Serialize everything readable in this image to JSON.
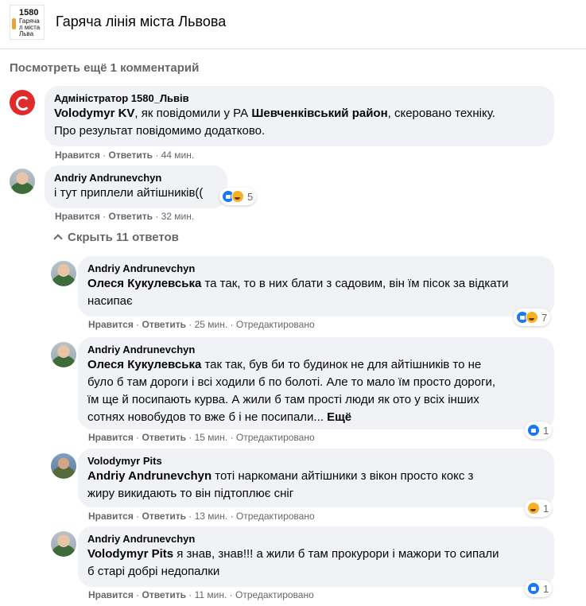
{
  "header": {
    "logo_num": "1580",
    "logo_sub": "Гаряча л міста Льва",
    "title": "Гаряча лінія міста Львова"
  },
  "see_more": "Посмотреть ещё 1 комментарий",
  "hide_replies": "Скрыть 11 ответов",
  "actions": {
    "like": "Нравится",
    "reply": "Ответить",
    "sep": " · ",
    "edited": "Отредактировано",
    "more": "Ещё"
  },
  "colors": {
    "like_blue": "#1877f2",
    "haha_yellow": "#f7b125",
    "bubble_bg": "#f0f2f5",
    "muted": "#65676b"
  },
  "comments": [
    {
      "author": "Адміністратор 1580_Львів",
      "mention": "Volodymyr KV",
      "text_1": ", як повідомили у РА ",
      "bold_2": "Шевченківський район",
      "text_2": ", скеровано техніку.",
      "line_2": "Про результат повідомимо додатково.",
      "time": "44 мин."
    },
    {
      "author": "Andriy Andrunevchyn",
      "text": "і тут приплели айтішників((",
      "time": "32 мин.",
      "reactions": {
        "icons": [
          "like-icon",
          "haha-icon"
        ],
        "count": "5"
      }
    },
    {
      "author": "Andriy Andrunevchyn",
      "mention": "Олеся Кукулевська",
      "line_1": " та так, то в них блати з садовим, він їм пісок за відкати",
      "line_2": "насипає",
      "time": "25 мин.",
      "reactions": {
        "icons": [
          "like-icon",
          "haha-icon"
        ],
        "count": "7"
      }
    },
    {
      "author": "Andriy Andrunevchyn",
      "mention": "Олеся Кукулевська",
      "line_1": " так так, був би то будинок не для айтішників то не",
      "line_2": "було б там дороги і всі ходили б по болоті. Але то мало їм просто дороги,",
      "line_3": "їм ще й посипають курва. А жили б там прості люди як ото у всіх інших",
      "line_4": "сотнях новобудов то вже б і не посипали... ",
      "time": "15 мин.",
      "reactions": {
        "icons": [
          "like-icon"
        ],
        "count": "1"
      }
    },
    {
      "author": "Volodymyr Pits",
      "mention": "Andriy Andrunevchyn",
      "line_1": " тоті наркомани айтішники з вікон просто кокс з",
      "line_2": "жиру викидають то він підтоплює сніг",
      "time": "13 мин.",
      "reactions": {
        "icons": [
          "haha-icon"
        ],
        "count": "1"
      }
    },
    {
      "author": "Andriy Andrunevchyn",
      "mention": "Volodymyr Pits",
      "line_1": " я знав, знав!!! а жили б там прокурори і мажори то сипали",
      "line_2": "б старі добрі недопалки",
      "time": "11 мин.",
      "reactions": {
        "icons": [
          "like-icon"
        ],
        "count": "1"
      }
    }
  ]
}
